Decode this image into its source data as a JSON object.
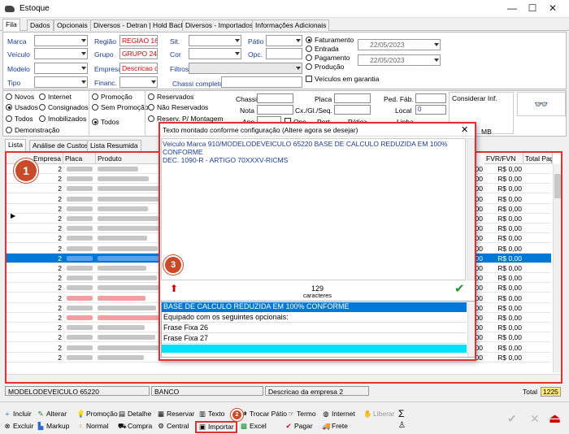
{
  "window": {
    "title": "Estoque",
    "minimize": "—",
    "maximize": "☐",
    "close": "✕"
  },
  "tabs": [
    "Fila",
    "Dados",
    "Opcionais",
    "Diversos - Detran | Hold Back",
    "Diversos - Importados",
    "Informações Adicionais"
  ],
  "filters": {
    "marca": "Marca",
    "veiculo": "Veículo",
    "modelo": "Modelo",
    "tipo": "Tipo",
    "regiao": "Região",
    "regiao_val": "REGIAO 16",
    "grupo": "Grupo",
    "grupo_val": "GRUPO 24",
    "empresa": "Empresa",
    "empresa_val": "Descricao c",
    "financ": "Financ.",
    "sit": "Sit.",
    "cor": "Cor",
    "filtros": "Filtros",
    "chassi_completo": "Chassi completo",
    "patio": "Pátio",
    "opc": "Opc.",
    "date1": "22/05/2023",
    "date2": "22/05/2023",
    "radio_fat": "Faturamento",
    "radio_ent": "Entrada",
    "radio_pag": "Pagamento",
    "radio_prod": "Produção",
    "veic_garantia": "Veículos em garantia"
  },
  "options": {
    "c1": [
      "Novos",
      "Usados",
      "Todos",
      "Demonstração"
    ],
    "c2": [
      "Internet",
      "Consignados",
      "Imobilizados"
    ],
    "c3": [
      "Promoção",
      "Sem Promoção",
      "Todos"
    ],
    "c4": [
      "Reservados",
      "Não Reservados",
      "Reserv. P/ Montagem"
    ],
    "fields": {
      "chassi": "Chassi",
      "nota": "Nota",
      "ano": "Ano",
      "placa": "Placa",
      "cxgl": "Cx./Gl./Seq.",
      "port": "Port.",
      "pedfab": "Ped. Fáb.",
      "local": "Local",
      "local_val": "0",
      "linha": "Linha",
      "patio2": "Pátio>",
      "opc": "Opc.",
      "consid": "Considerar Inf.",
      "mb": "MB"
    }
  },
  "list_tabs": [
    "Lista",
    "Análise de Custos",
    "Lista Resumida"
  ],
  "grid": {
    "headers": [
      "Empresa",
      "Placa",
      "Produto",
      "FVR/FVN",
      "Total Pag"
    ],
    "empresa_val": "2",
    "rows": [
      {
        "p": "0,00",
        "v": "R$ 0,00"
      },
      {
        "p": "0,00",
        "v": "R$ 0,00"
      },
      {
        "p": "0,00",
        "v": "R$ 0,00"
      },
      {
        "p": "0,00",
        "v": "R$ 0,00"
      },
      {
        "p": "0,00",
        "v": "R$ 0,00"
      },
      {
        "p": "0,00",
        "v": "R$ 0,00"
      },
      {
        "p": "0,00",
        "v": "R$ 0,00"
      },
      {
        "p": "0,00",
        "v": "R$ 0,00"
      },
      {
        "p": "0,00",
        "v": "R$ 0,00"
      },
      {
        "p": "0,00",
        "v": "R$ 0,00"
      },
      {
        "p": "0,00",
        "v": "R$ 0,00"
      },
      {
        "p": "0,00",
        "v": "R$ 0,00"
      },
      {
        "p": "0,00",
        "v": "R$ 0,00"
      },
      {
        "p": "0,00",
        "v": "R$ 0,00"
      },
      {
        "p": "0,00",
        "v": "R$ 0,00"
      },
      {
        "p": "0,00",
        "v": "R$ 0,00"
      },
      {
        "p": "0,00",
        "v": "R$ 0,00"
      },
      {
        "p": "0,00",
        "v": "R$ 0,00"
      },
      {
        "p": "0,00",
        "v": "R$ 0,00"
      },
      {
        "p": "0,00",
        "v": "R$ 0,00"
      }
    ]
  },
  "dialog": {
    "title": "Texto montado conforme configuração (Altere agora se desejar)",
    "text_line1": "Veiculo Marca 910/MODELODEVEICULO 65220   BASE DE CALCULO REDUZIDA EM 100% CONFORME",
    "text_line2": "DEC. 1090-R - ARTIGO 70XXXV-RICMS",
    "count": "129",
    "count_label": "caracteres",
    "list": [
      "BASE DE CALCULO REDUZIDA EM 100% CONFORME",
      "Equipado com os seguintes opcionais:",
      "Frase Fixa 26",
      "Frase Fixa 27",
      ""
    ]
  },
  "status_bar": {
    "modelo": "MODELODEVEICULO 65220",
    "banco": "BANCO",
    "desc": "Descricao da empresa 2",
    "total_label": "Total",
    "total_val": "1225"
  },
  "toolbar": {
    "row1": [
      "Incluir",
      "Alterar",
      "Promoção",
      "Detalhe",
      "Reservar",
      "Texto",
      "Trocar Pátio",
      "Termo",
      "Internet",
      "Liberar",
      "Σ"
    ],
    "row2": [
      "Excluir",
      "Markup",
      "Normal",
      "Compra",
      "Central",
      "Importar",
      "Excel",
      "Pagar",
      "Frete"
    ]
  },
  "badges": [
    "1",
    "2",
    "3"
  ],
  "colors": {
    "accent": "#e03030",
    "selection": "#0078d7",
    "label_blue": "#1a3a9a",
    "badge": "#c84a28"
  }
}
